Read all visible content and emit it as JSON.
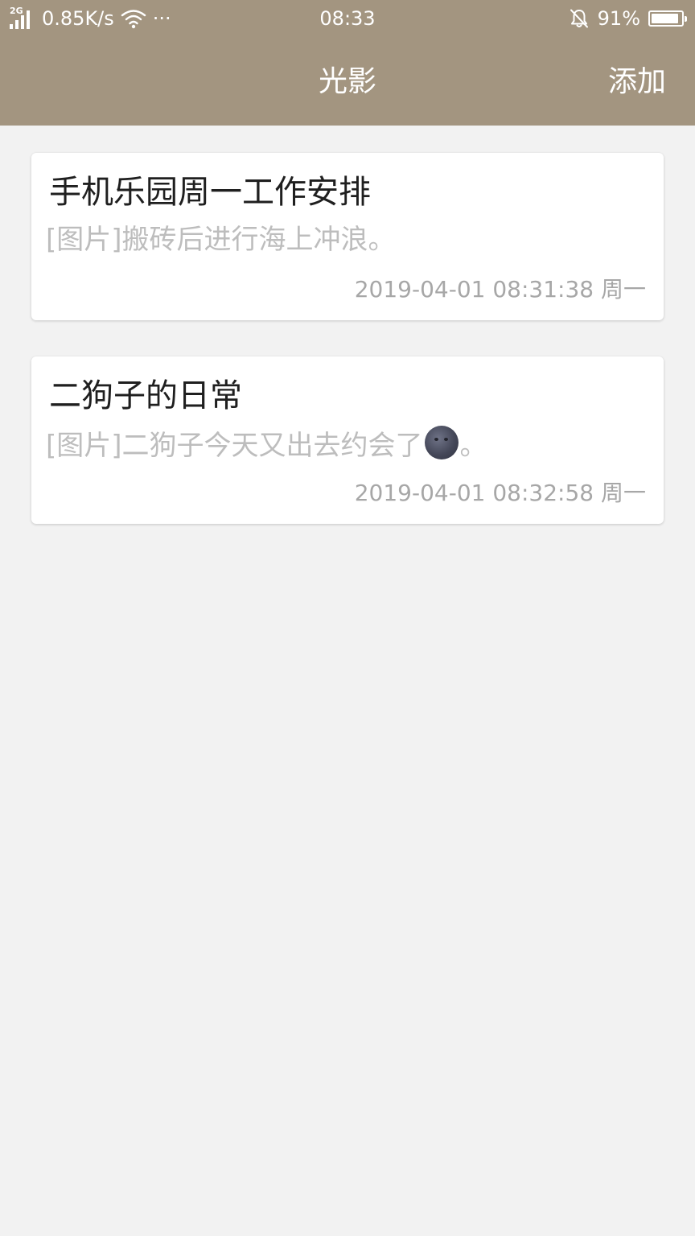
{
  "status_bar": {
    "network_type": "2G",
    "speed": "0.85K/s",
    "more": "···",
    "time": "08:33",
    "battery": "91%",
    "icons": [
      "signal-icon",
      "wifi-icon",
      "bell-muted-icon",
      "battery-icon"
    ],
    "battery_level": 0.91
  },
  "nav": {
    "title": "光影",
    "add_label": "添加"
  },
  "entries": [
    {
      "title": "手机乐园周一工作安排",
      "preview": "[图片]搬砖后进行海上冲浪。",
      "date": "2019-04-01 08:31:38 周一"
    },
    {
      "title": "二狗子的日常",
      "preview_before": "[图片]二狗子今天又出去约会了",
      "preview_emoji": "new-moon-face-emoji",
      "preview_after": "。",
      "date": "2019-04-01 08:32:58 周一"
    }
  ],
  "colors": {
    "header": "#a39580",
    "background": "#f2f2f2",
    "card": "#ffffff",
    "title_text": "#1f1f1f",
    "preview_text": "#bdbdbd",
    "date_text": "#a7a7a7"
  }
}
